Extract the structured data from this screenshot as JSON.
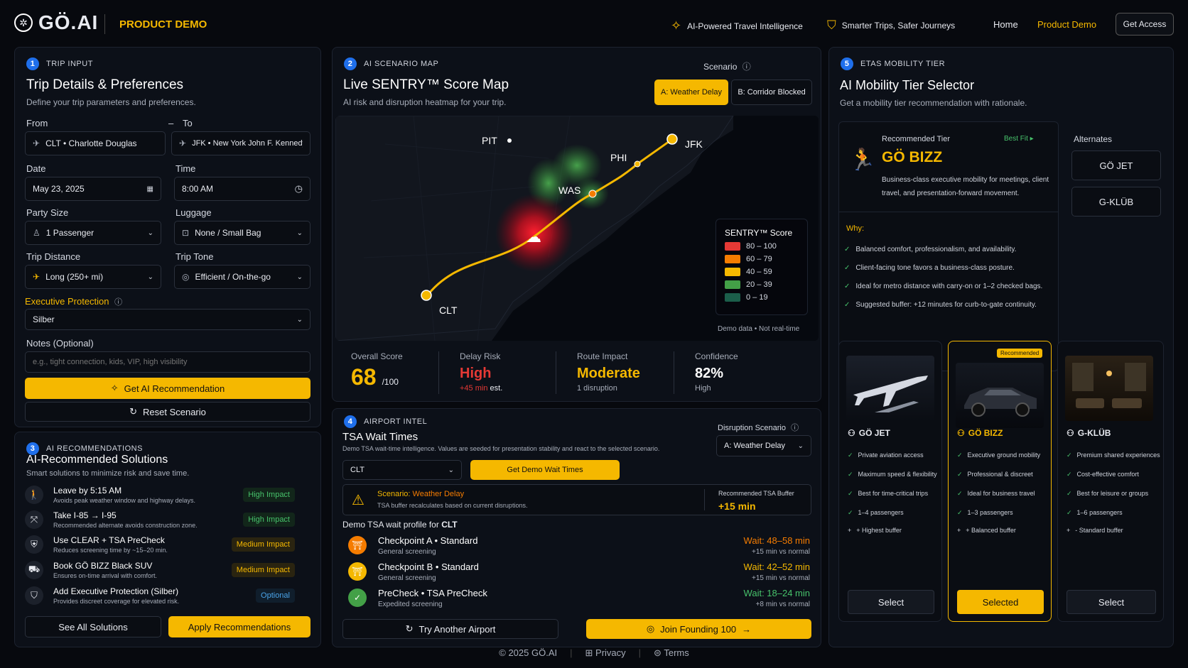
{
  "header": {
    "logo": "GÖ.AI",
    "subtitle": "PRODUCT DEMO",
    "tagline1": "AI-Powered Travel Intelligence",
    "tagline2": "Smarter Trips, Safer Journeys",
    "nav": [
      "Home",
      "Product Demo"
    ],
    "cta": "Get Access",
    "colors": {
      "accent": "#f5b800",
      "primary": "#1f6feb"
    }
  },
  "trip": {
    "step": "1",
    "tag": "TRIP INPUT",
    "title": "Trip Details & Preferences",
    "subtitle": "Define your trip parameters and preferences.",
    "from_label": "From",
    "to_label": "To",
    "from": "CLT • Charlotte Douglas",
    "to": "JFK • New York John F. Kennedy",
    "date_label": "Date",
    "date": "May 23, 2025",
    "time_label": "Time",
    "time": "8:00 AM",
    "party_label": "Party Size",
    "party": "1 Passenger",
    "luggage_label": "Luggage",
    "luggage": "None / Small Bag",
    "distance_label": "Trip Distance",
    "distance": "Long (250+ mi)",
    "tone_label": "Trip Tone",
    "tone": "Efficient / On-the-go",
    "ep_label": "Executive Protection",
    "ep": "Silber",
    "notes_label": "Notes (Optional)",
    "notes_placeholder": "e.g., tight connection, kids, VIP, high visibility",
    "get_btn": "Get AI Recommendation",
    "reset_btn": "Reset Scenario"
  },
  "recs": {
    "step": "3",
    "tag": "AI RECOMMENDATIONS",
    "title": "AI-Recommended Solutions",
    "subtitle": "Smart solutions to minimize risk and save time.",
    "items": [
      {
        "title": "Leave by 5:15 AM",
        "desc": "Avoids peak weather window and highway delays.",
        "badge": "High Impact",
        "icon": "walking-person-icon"
      },
      {
        "title": "Take I-85 → I-95",
        "desc": "Recommended alternate avoids construction zone.",
        "badge": "High Impact",
        "icon": "route-icon"
      },
      {
        "title": "Use CLEAR + TSA PreCheck",
        "desc": "Reduces screening time by ~15–20 min.",
        "badge": "Medium Impact",
        "icon": "security-icon"
      },
      {
        "title": "Book GÖ BIZZ Black SUV",
        "desc": "Ensures on-time arrival with comfort.",
        "badge": "Medium Impact",
        "icon": "car-icon"
      },
      {
        "title": "Add Executive Protection (Silber)",
        "desc": "Provides discreet coverage for elevated risk.",
        "badge": "Optional",
        "icon": "shield-icon"
      }
    ],
    "see_all": "See All Solutions",
    "apply": "Apply Recommendations"
  },
  "map": {
    "step": "2",
    "tag": "AI SCENARIO MAP",
    "title": "Live SENTRY™ Score Map",
    "subtitle": "AI risk and disruption heatmap for your trip.",
    "scenario_label": "Scenario",
    "scenario_a": "A: Weather Delay",
    "scenario_b": "B: Corridor Blocked",
    "cities": [
      "PIT",
      "PHI",
      "WAS",
      "JFK",
      "CLT"
    ],
    "legend_title": "SENTRY™ Score",
    "legend": [
      {
        "range": "80 – 100",
        "color": "#e53935"
      },
      {
        "range": "60 – 79",
        "color": "#f57c00"
      },
      {
        "range": "40 – 59",
        "color": "#f5b800"
      },
      {
        "range": "20 – 39",
        "color": "#43a047"
      },
      {
        "range": "0 – 19",
        "color": "#1b5e4a"
      }
    ],
    "note": "Demo data • Not real-time",
    "overall_label": "Overall Score",
    "overall": "68",
    "overall_of": "/100",
    "delay_label": "Delay Risk",
    "delay": "High",
    "delay_sub_a": "+45 min",
    "delay_sub_b": "est.",
    "route_label": "Route Impact",
    "route": "Moderate",
    "route_sub": "1 disruption",
    "conf_label": "Confidence",
    "conf": "82%",
    "conf_sub": "High"
  },
  "intel": {
    "step": "4",
    "tag": "AIRPORT INTEL",
    "title": "TSA Wait Times",
    "subtitle": "Demo TSA wait-time intelligence. Values are seeded for presentation stability and react to the selected scenario.",
    "disruption_label": "Disruption Scenario",
    "disruption": "A: Weather Delay",
    "airport": "CLT",
    "get_btn": "Get Demo Wait Times",
    "alert_prefix": "Scenario:",
    "alert_scenario": "Weather Delay",
    "alert_desc": "TSA buffer recalculates based on current disruptions.",
    "buffer_label": "Recommended TSA Buffer",
    "buffer": "+15 min",
    "profile_prefix": "Demo TSA wait profile for",
    "profile_airport": "CLT",
    "checkpoints": [
      {
        "name": "Checkpoint A • Standard",
        "sub": "General screening",
        "wait": "Wait: 48–58 min",
        "delta": "+15 min vs normal",
        "color": "#f57c00"
      },
      {
        "name": "Checkpoint B • Standard",
        "sub": "General screening",
        "wait": "Wait: 42–52 min",
        "delta": "+15 min vs normal",
        "color": "#f5b800"
      },
      {
        "name": "PreCheck • TSA PreCheck",
        "sub": "Expedited screening",
        "wait": "Wait: 18–24 min",
        "delta": "+8 min vs normal",
        "color": "#43a047"
      }
    ],
    "try_btn": "Try Another Airport",
    "join_btn": "Join Founding 100"
  },
  "tier": {
    "step": "5",
    "tag": "ETAS MOBILITY TIER",
    "title": "AI Mobility Tier Selector",
    "subtitle": "Get a mobility tier recommendation with rationale.",
    "rec_label": "Recommended Tier",
    "best_fit": "Best Fit",
    "rec_name": "GÖ BIZZ",
    "rec_desc": "Business-class executive mobility for meetings, client travel, and presentation-forward movement.",
    "why_label": "Why:",
    "why": [
      "Balanced comfort, professionalism, and availability.",
      "Client-facing tone favors a business-class posture.",
      "Ideal for metro distance with carry-on or 1–2 checked bags.",
      "Suggested buffer: +12 minutes for curb-to-gate continuity."
    ],
    "alternates_label": "Alternates",
    "alternates": [
      "GÖ JET",
      "G-KLÜB"
    ],
    "cards": [
      {
        "name": "GÖ JET",
        "features": [
          "Private aviation access",
          "Maximum speed & flexibility",
          "Best for time-critical trips",
          "1–4 passengers"
        ],
        "extra": "+ Highest buffer",
        "button": "Select"
      },
      {
        "name": "GÖ BIZZ",
        "badge": "Recommended",
        "features": [
          "Executive ground mobility",
          "Professional & discreet",
          "Ideal for business travel",
          "1–3 passengers"
        ],
        "extra": "+ Balanced buffer",
        "button": "Selected"
      },
      {
        "name": "G-KLÜB",
        "features": [
          "Premium shared experiences",
          "Cost-effective comfort",
          "Best for leisure or groups",
          "1–6 passengers"
        ],
        "extra": "- Standard buffer",
        "button": "Select"
      }
    ]
  },
  "footer": {
    "copy": "© 2025 GÖ.AI",
    "privacy": "Privacy",
    "terms": "Terms"
  }
}
